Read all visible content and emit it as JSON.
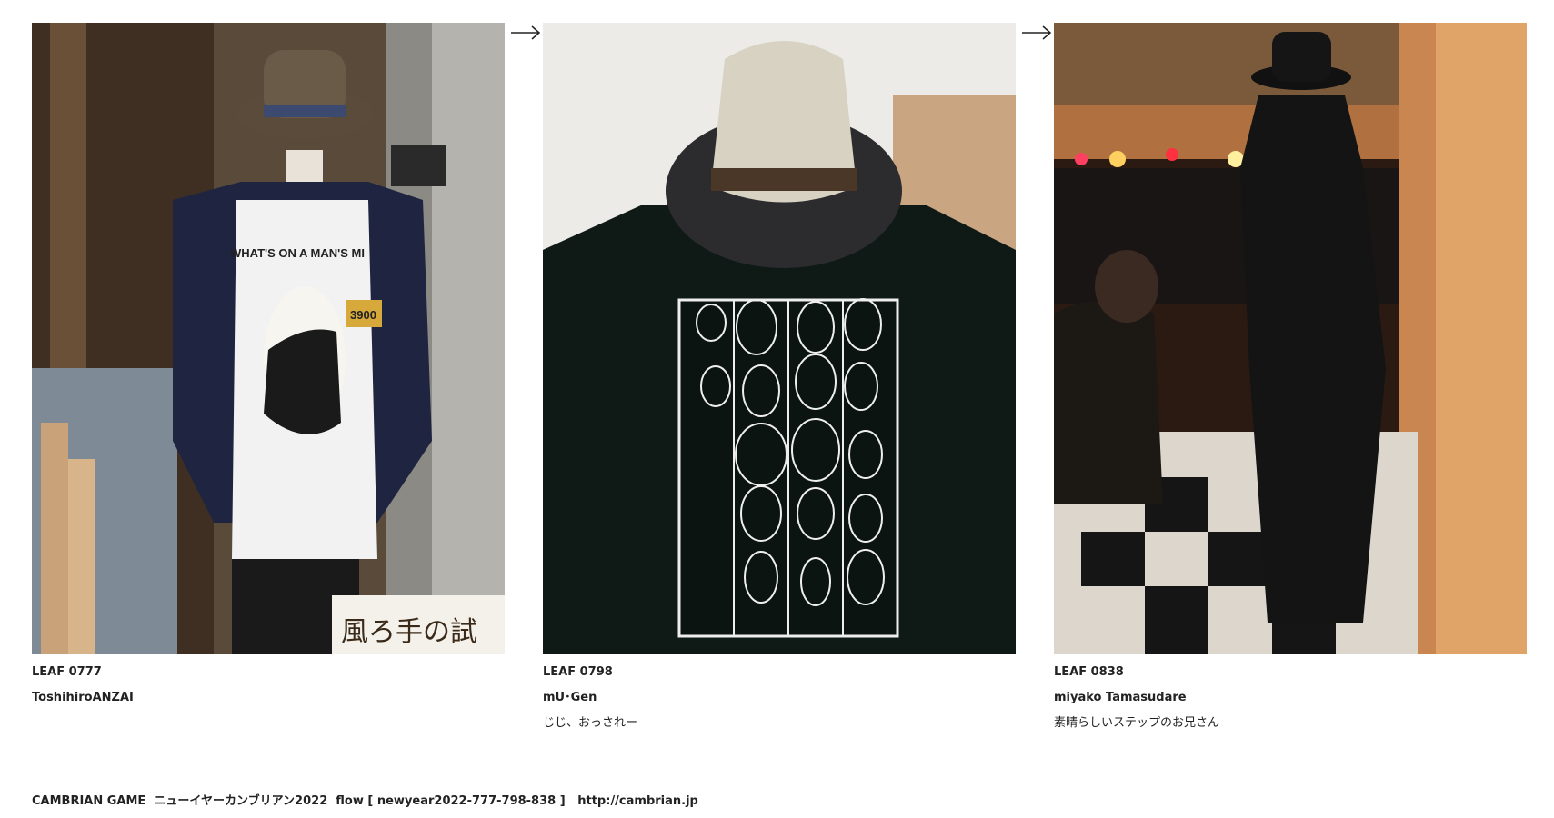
{
  "leaves": [
    {
      "code": "LEAF 0777",
      "author": "ToshihiroANZAI",
      "comment": "",
      "shirt_text": "WHAT'S ON A MAN'S MI",
      "price_tag": "3900",
      "sign_text": "風ろ手の試"
    },
    {
      "code": "LEAF 0798",
      "author": "mU･Gen",
      "comment": "じじ、おっされー"
    },
    {
      "code": "LEAF 0838",
      "author": "miyako Tamasudare",
      "comment": "素晴らしいステップのお兄さん"
    }
  ],
  "footer": {
    "title": "CAMBRIAN GAME  ニューイヤーカンブリアン2022  flow [ newyear2022-777-798-838 ]",
    "url": "http://cambrian.jp"
  },
  "arrow_icon": "right-arrow-icon",
  "colors": {
    "text": "#222222",
    "background": "#ffffff"
  }
}
